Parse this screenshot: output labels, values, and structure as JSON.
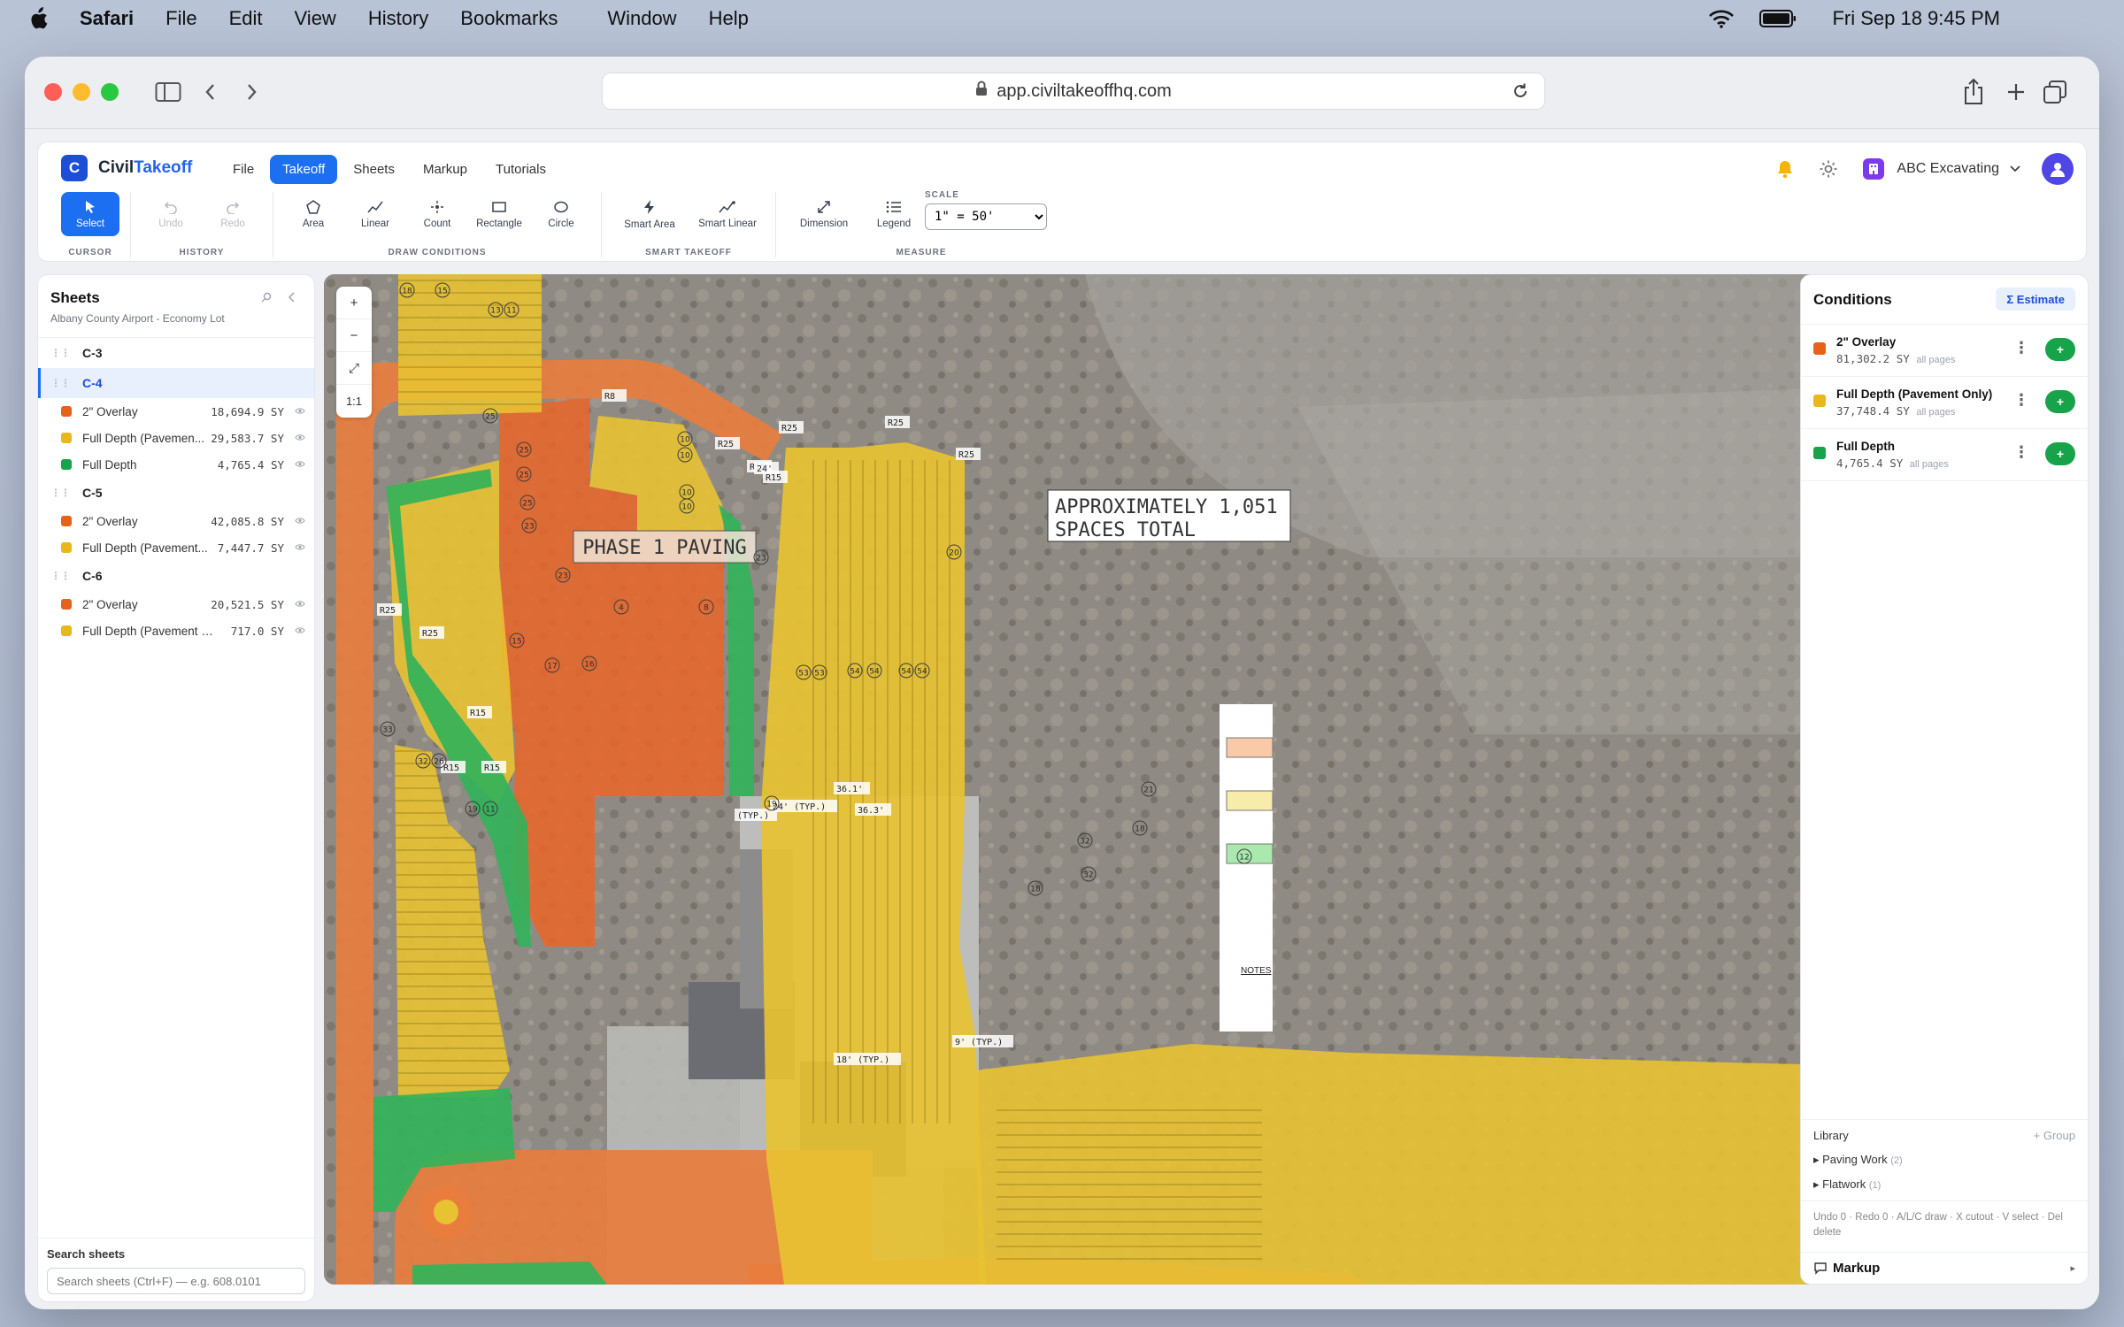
{
  "menubar": {
    "app": "Safari",
    "items": [
      "File",
      "Edit",
      "View",
      "History",
      "Bookmarks",
      "Window",
      "Help"
    ],
    "clock": "Fri Sep 18 9:45 PM"
  },
  "browser": {
    "url": "app.civiltakeoffhq.com"
  },
  "app": {
    "brand_a": "Civil",
    "brand_b": "Takeoff",
    "logo_letter": "C",
    "nav": [
      "File",
      "Takeoff",
      "Sheets",
      "Markup",
      "Tutorials"
    ],
    "active_nav": "Takeoff",
    "account": "ABC Excavating"
  },
  "toolbar": {
    "select": "Select",
    "undo": "Undo",
    "redo": "Redo",
    "area": "Area",
    "linear": "Linear",
    "count": "Count",
    "rectangle": "Rectangle",
    "circle": "Circle",
    "smart_area": "Smart Area",
    "smart_linear": "Smart Linear",
    "dimension": "Dimension",
    "legend": "Legend",
    "scale_label": "SCALE",
    "scale_value": "1\" = 50'",
    "groups": {
      "cursor": "CURSOR",
      "history": "HISTORY",
      "draw": "DRAW CONDITIONS",
      "smart": "SMART TAKEOFF",
      "measure": "MEASURE"
    }
  },
  "sheets_panel": {
    "title": "Sheets",
    "subtitle": "Albany County Airport - Economy Lot",
    "sheets": [
      {
        "name": "C-3",
        "conditions": []
      },
      {
        "name": "C-4",
        "conditions": [
          {
            "name": "2\" Overlay",
            "value": "18,694.9 SY",
            "color": "#e8611a"
          },
          {
            "name": "Full Depth (Pavemen...",
            "value": "29,583.7 SY",
            "color": "#e8b71a"
          },
          {
            "name": "Full Depth",
            "value": "4,765.4 SY",
            "color": "#16a34a"
          }
        ]
      },
      {
        "name": "C-5",
        "conditions": [
          {
            "name": "2\" Overlay",
            "value": "42,085.8 SY",
            "color": "#e8611a"
          },
          {
            "name": "Full Depth (Pavement...",
            "value": "7,447.7 SY",
            "color": "#e8b71a"
          }
        ]
      },
      {
        "name": "C-6",
        "conditions": [
          {
            "name": "2\" Overlay",
            "value": "20,521.5 SY",
            "color": "#e8611a"
          },
          {
            "name": "Full Depth (Pavement O...",
            "value": "717.0 SY",
            "color": "#e8b71a"
          }
        ]
      }
    ],
    "search_label": "Search sheets",
    "search_placeholder": "Search sheets (Ctrl+F) — e.g. 608.0101"
  },
  "map": {
    "zoom_in": "+",
    "zoom_out": "−",
    "fit": "⤢",
    "one_to_one": "1:1",
    "phase_label": "PHASE 1 PAVING",
    "spaces_line1": "APPROXIMATELY 1,051",
    "spaces_line2": "SPACES TOTAL",
    "notes_label": "NOTES",
    "labels": [
      "R8",
      "R25",
      "R25",
      "R25",
      "R25",
      "R25",
      "R25",
      "R15",
      "R15",
      "R15",
      "R15",
      "R15",
      "24'",
      "(TYP.)",
      "24' (TYP.)",
      "18' (TYP.)",
      "9' (TYP.)",
      "36.1'",
      "36.3'"
    ],
    "counts": [
      "18",
      "15",
      "13",
      "11",
      "25",
      "25",
      "25",
      "25",
      "23",
      "23",
      "10",
      "10",
      "10",
      "10",
      "17",
      "16",
      "15",
      "4",
      "8",
      "23",
      "20",
      "53",
      "53",
      "54",
      "54",
      "54",
      "54",
      "33",
      "32",
      "26",
      "19",
      "11",
      "19",
      "21",
      "18",
      "32",
      "32",
      "18",
      "12"
    ]
  },
  "conditions_panel": {
    "title": "Conditions",
    "estimate": "Σ Estimate",
    "items": [
      {
        "name": "2\" Overlay",
        "value": "81,302.2 SY",
        "scope": "all pages",
        "color": "#e8611a"
      },
      {
        "name": "Full Depth (Pavement Only)",
        "value": "37,748.4 SY",
        "scope": "all pages",
        "color": "#e8b71a"
      },
      {
        "name": "Full Depth",
        "value": "4,765.4 SY",
        "scope": "all pages",
        "color": "#16a34a"
      }
    ],
    "library_title": "Library",
    "library_group": "+ Group",
    "library_items": [
      {
        "name": "Paving Work",
        "count": "(2)"
      },
      {
        "name": "Flatwork",
        "count": "(1)"
      }
    ],
    "shortcuts": "Undo 0 · Redo 0 · A/L/C draw · X cutout · V select · Del delete",
    "markup": "Markup"
  }
}
